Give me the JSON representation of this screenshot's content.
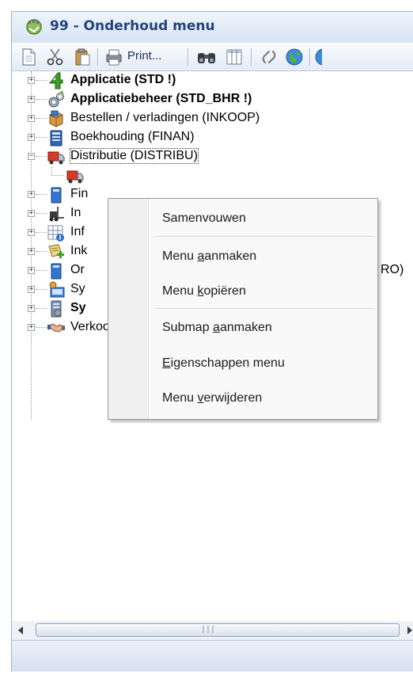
{
  "window": {
    "title": "99 - Onderhoud menu"
  },
  "toolbar": {
    "print_label": "Print..."
  },
  "tree": {
    "items": [
      {
        "label": "Applicatie (STD !)",
        "bold": true,
        "icon": "applicatie-icon",
        "expanded": false
      },
      {
        "label": "Applicatiebeheer (STD_BHR !)",
        "bold": true,
        "icon": "gears-icon",
        "expanded": false
      },
      {
        "label": "Bestellen / verladingen (INKOOP)",
        "bold": false,
        "icon": "package-icon",
        "expanded": false
      },
      {
        "label": "Boekhouding (FINAN)",
        "bold": false,
        "icon": "ledger-icon",
        "expanded": false
      },
      {
        "label": "Distributie (DISTRIBU)",
        "bold": false,
        "icon": "truck-icon",
        "expanded": true,
        "selected": true
      },
      {
        "label": "",
        "bold": false,
        "icon": "truck-icon",
        "child": true
      },
      {
        "label": "Fin",
        "bold": false,
        "icon": "book-icon",
        "expanded": false
      },
      {
        "label": "In",
        "bold": false,
        "icon": "forklift-icon",
        "expanded": false
      },
      {
        "label": "Inf",
        "bold": false,
        "icon": "info-table-icon",
        "expanded": false
      },
      {
        "label": "Ink",
        "bold": false,
        "icon": "add-doc-icon",
        "expanded": false
      },
      {
        "label": "Or",
        "bold": false,
        "icon": "book-icon",
        "expanded": false,
        "suffix": "RO)"
      },
      {
        "label": "Sy",
        "bold": false,
        "icon": "system-icon",
        "expanded": false
      },
      {
        "label": "Sy",
        "bold": true,
        "icon": "server-icon",
        "expanded": false
      },
      {
        "label": "Verkoop (VERKOOP)",
        "bold": false,
        "icon": "handshake-icon",
        "expanded": false
      }
    ]
  },
  "context_menu": {
    "items": [
      {
        "id": "samenvouwen",
        "pre": "Samenvouwen",
        "ul": "",
        "post": ""
      },
      {
        "id": "menu-aanmaken",
        "pre": "Menu ",
        "ul": "a",
        "post": "anmaken"
      },
      {
        "id": "menu-kopieren",
        "pre": "Menu ",
        "ul": "k",
        "post": "opiëren"
      },
      {
        "id": "submap-aanmaken",
        "pre": "Submap ",
        "ul": "a",
        "post": "anmaken"
      },
      {
        "id": "eigenschappen-menu",
        "pre": "",
        "ul": "E",
        "post": "igenschappen menu"
      },
      {
        "id": "menu-verwijderen",
        "pre": "Menu ",
        "ul": "v",
        "post": "erwijderen"
      }
    ]
  },
  "scrollbar": {
    "grip": "|||"
  },
  "colors": {
    "title_text": "#27437a",
    "accent": "#9db3cf"
  }
}
